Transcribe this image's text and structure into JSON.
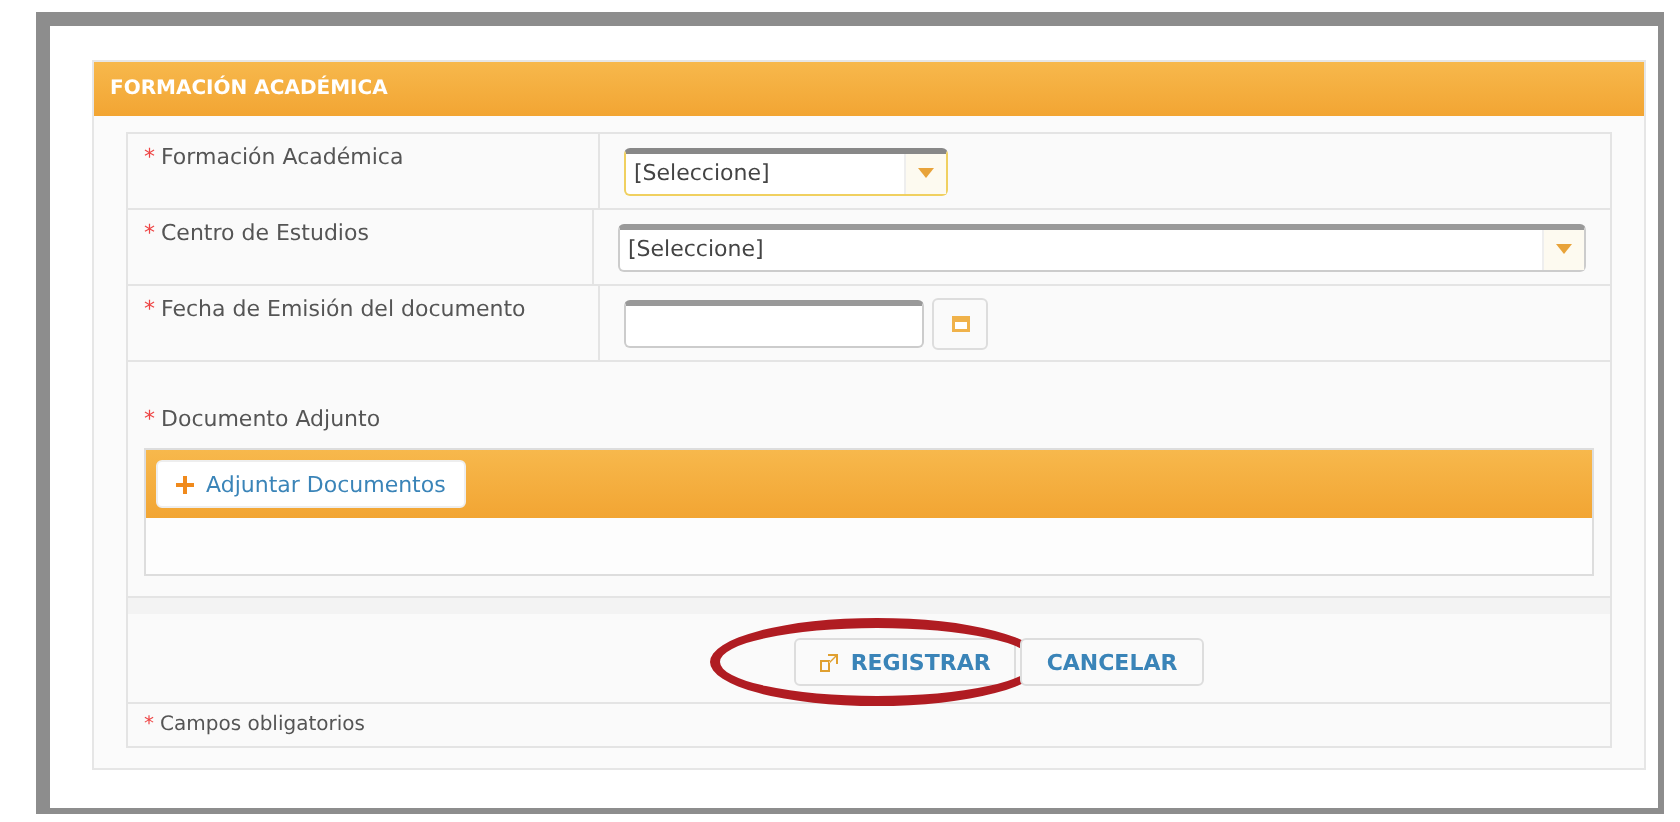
{
  "panel": {
    "title": "FORMACIÓN ACADÉMICA"
  },
  "fields": [
    {
      "kind": "select",
      "label": "Formación Académica",
      "required": true,
      "value": "[Seleccione]",
      "focused": true
    },
    {
      "kind": "combobox",
      "label": "Centro de Estudios",
      "required": true,
      "value": "[Seleccione]",
      "focused": false
    },
    {
      "kind": "date",
      "label": "Fecha de Emisión del documento",
      "required": true,
      "focused": false
    }
  ],
  "attachment": {
    "label": "Documento Adjunto",
    "required": true,
    "button": "Adjuntar Documentos"
  },
  "buttons": [
    {
      "label": "REGISTRAR",
      "kind": "register",
      "highlighted": true
    },
    {
      "label": "CANCELAR",
      "kind": "cancel",
      "highlighted": false
    }
  ],
  "footnote": "Campos obligatorios",
  "required_mark": "*"
}
